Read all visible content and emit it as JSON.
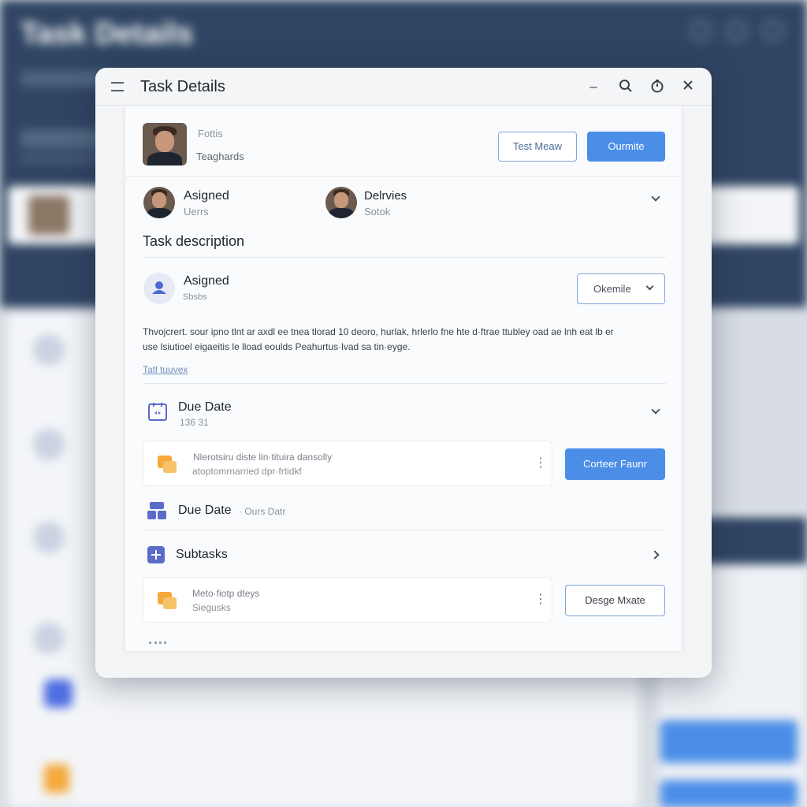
{
  "background": {
    "title": "Task Details"
  },
  "window": {
    "title": "Task Details"
  },
  "header": {
    "name": "Fottis",
    "role": "Teaghards",
    "btn_secondary": "Test Meaw",
    "btn_primary": "Ourmite"
  },
  "people": [
    {
      "name": "Asigned",
      "sub": "Uerrs"
    },
    {
      "name": "Delrvies",
      "sub": "Sotok"
    }
  ],
  "task_description": {
    "heading": "Task description",
    "assigned_label": "Asigned",
    "assigned_sub": "Sbsbs",
    "dropdown_value": "Okemile",
    "body_line1": "Thvojcrert. sour ipno tlnt ar axdl ee tnea tlorad 10 deoro, hurlak, hrlerlo fne hte d·ftrae ttubley oad ae lnh eat lb er",
    "body_line2": "use lsiutioel eigaeitis le lload eoulds Peahurtus·lvad sa tin·eyge.",
    "link": "Tatl tuuvex"
  },
  "due_date": {
    "label": "Due Date",
    "sub": "136 31"
  },
  "attachment1": {
    "line1": "Nlerotsiru diste lin·tituira dansolly",
    "line2": "atoptomrnarried dpr·frtidkf",
    "button": "Corteer Faunr"
  },
  "due_date2": {
    "label": "Due Date",
    "sub": "· Ours Datr"
  },
  "subtasks": {
    "label": "Subtasks"
  },
  "attachment2": {
    "line1": "Meto·fiotp dteys",
    "line2": "Siegusks",
    "button": "Desge Mxate"
  },
  "colors": {
    "accent": "#4a8ee8",
    "band": "#2f4563",
    "folder": "#f5a93b",
    "icon_blue": "#5b6bc8"
  }
}
